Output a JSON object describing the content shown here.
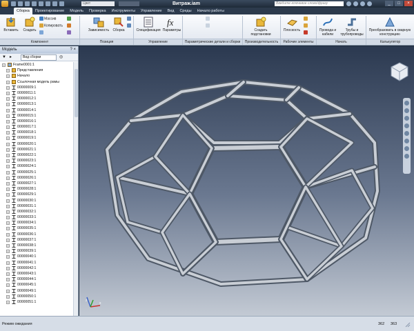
{
  "titlebar": {
    "style_combo": "Цвет",
    "window_title": "Витраж.iam",
    "search_placeholder": "Введите ключевое слово/фразу"
  },
  "ribbon": {
    "tabs": [
      "Сборка",
      "Проектирование",
      "Модель",
      "Проверка",
      "Инструменты",
      "Управление",
      "Вид",
      "Среды",
      "Начало работы"
    ],
    "active_tab": 0,
    "buttons": {
      "insert": "Вставить",
      "create": "Создать",
      "pattern": "Массив",
      "copy": "Копировать",
      "constrain": "Зависимость",
      "assemble": "Сборка",
      "bom": "Спецификация",
      "parameters": "Параметры",
      "create_substitute": "Создать подстановки",
      "plane": "Плоскость",
      "cables": "Провода и кабели",
      "tubes": "Трубы и трубопроводы",
      "convert_weldment": "Преобразовать в сварную конструкцию"
    },
    "groups": [
      "Компонент",
      "Позиция",
      "Управление",
      "Параметрические детали и сборки",
      "Производительность",
      "Рабочие элементы",
      "Начать",
      "Калькулятор"
    ]
  },
  "browser": {
    "title": "Модель",
    "view_label": "Вид сборки",
    "root": "Frame0001:1",
    "fixed_items": [
      "Представления",
      "Начало",
      "Ссылочная модель рамы"
    ],
    "members": [
      "00000009:1",
      "00000011:1",
      "00000012:1",
      "00000013:1",
      "00000014:1",
      "00000015:1",
      "00000016:1",
      "00000017:1",
      "00000018:1",
      "00000019:1",
      "00000020:1",
      "00000021:1",
      "00000022:1",
      "00000023:1",
      "00000024:1",
      "00000025:1",
      "00000026:1",
      "00000027:1",
      "00000028:1",
      "00000029:1",
      "00000030:1",
      "00000031:1",
      "00000032:1",
      "00000033:1",
      "00000034:1",
      "00000035:1",
      "00000036:1",
      "00000037:1",
      "00000038:1",
      "00000039:1",
      "00000040:1",
      "00000041:1",
      "00000042:1",
      "00000043:1",
      "00000044:1",
      "00000045:1",
      "00000049:1",
      "00000050:1",
      "00000051:1"
    ]
  },
  "status": {
    "message": "Режим ожидания",
    "count1": "362",
    "count2": "363"
  },
  "icons": [
    "application-menu-icon",
    "insert-icon",
    "create-icon",
    "pattern-icon",
    "copy-icon",
    "constraint-icon",
    "assemble-icon",
    "bom-icon",
    "fx-icon",
    "substitute-icon",
    "plane-icon",
    "cable-icon",
    "tube-icon",
    "weldment-icon",
    "filter-icon",
    "binoculars-icon",
    "viewcube-icon",
    "navigation-bar-icon",
    "axis-triad-icon"
  ],
  "colors": {
    "background_top": "#2b3950",
    "background_bottom": "#c3cad4",
    "frame_member": "#c9ced5",
    "ribbon": "#eef2f7"
  }
}
